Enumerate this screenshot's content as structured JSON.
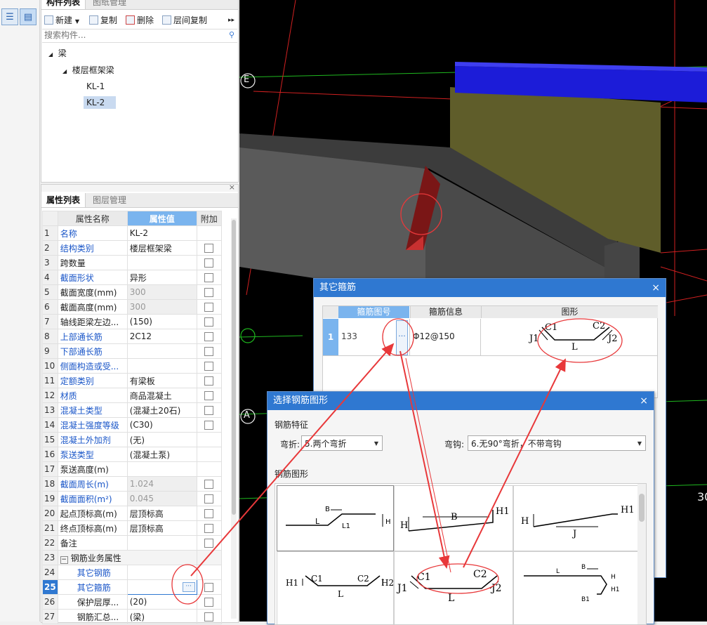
{
  "left_toolbar": {
    "list_icon": "list-view-icon",
    "detail_icon": "detail-view-icon"
  },
  "component_panel": {
    "tabs": [
      "构件列表",
      "图纸管理"
    ],
    "toolbar": {
      "new": "新建",
      "copy": "复制",
      "delete": "删除",
      "floor_copy": "层间复制",
      "more": "▸▸"
    },
    "search_placeholder": "搜索构件...",
    "tree": {
      "root": "梁",
      "category": "楼层框架梁",
      "items": [
        "KL-1",
        "KL-2"
      ],
      "selected": "KL-2"
    }
  },
  "property_panel": {
    "tabs": [
      "属性列表",
      "图层管理"
    ],
    "close": "×",
    "headers": {
      "name": "属性名称",
      "value": "属性值",
      "extra": "附加"
    },
    "rows": [
      {
        "n": "1",
        "name": "名称",
        "value": "KL-2",
        "blue": true,
        "cb": false,
        "gray": false
      },
      {
        "n": "2",
        "name": "结构类别",
        "value": "楼层框架梁",
        "blue": true,
        "cb": true,
        "gray": false
      },
      {
        "n": "3",
        "name": "跨数量",
        "value": "",
        "blue": false,
        "cb": true,
        "gray": false
      },
      {
        "n": "4",
        "name": "截面形状",
        "value": "异形",
        "blue": true,
        "cb": true,
        "gray": false
      },
      {
        "n": "5",
        "name": "截面宽度(mm)",
        "value": "300",
        "blue": false,
        "cb": true,
        "gray": true
      },
      {
        "n": "6",
        "name": "截面高度(mm)",
        "value": "300",
        "blue": false,
        "cb": true,
        "gray": true
      },
      {
        "n": "7",
        "name": "轴线距梁左边...",
        "value": "(150)",
        "blue": false,
        "cb": true,
        "gray": false
      },
      {
        "n": "8",
        "name": "上部通长筋",
        "value": "2C12",
        "blue": true,
        "cb": true,
        "gray": false
      },
      {
        "n": "9",
        "name": "下部通长筋",
        "value": "",
        "blue": true,
        "cb": true,
        "gray": false
      },
      {
        "n": "10",
        "name": "侧面构造或受...",
        "value": "",
        "blue": true,
        "cb": true,
        "gray": false
      },
      {
        "n": "11",
        "name": "定额类别",
        "value": "有梁板",
        "blue": true,
        "cb": true,
        "gray": false
      },
      {
        "n": "12",
        "name": "材质",
        "value": "商品混凝土",
        "blue": true,
        "cb": true,
        "gray": false
      },
      {
        "n": "13",
        "name": "混凝土类型",
        "value": "(混凝土20石)",
        "blue": true,
        "cb": true,
        "gray": false
      },
      {
        "n": "14",
        "name": "混凝土强度等级",
        "value": "(C30)",
        "blue": true,
        "cb": true,
        "gray": false
      },
      {
        "n": "15",
        "name": "混凝土外加剂",
        "value": "(无)",
        "blue": true,
        "cb": false,
        "gray": false
      },
      {
        "n": "16",
        "name": "泵送类型",
        "value": "(混凝土泵)",
        "blue": true,
        "cb": false,
        "gray": false
      },
      {
        "n": "17",
        "name": "泵送高度(m)",
        "value": "",
        "blue": false,
        "cb": false,
        "gray": false
      },
      {
        "n": "18",
        "name": "截面周长(m)",
        "value": "1.024",
        "blue": true,
        "cb": true,
        "gray": true
      },
      {
        "n": "19",
        "name": "截面面积(m²)",
        "value": "0.045",
        "blue": true,
        "cb": true,
        "gray": true
      },
      {
        "n": "20",
        "name": "起点顶标高(m)",
        "value": "层顶标高",
        "blue": false,
        "cb": true,
        "gray": false
      },
      {
        "n": "21",
        "name": "终点顶标高(m)",
        "value": "层顶标高",
        "blue": false,
        "cb": true,
        "gray": false
      },
      {
        "n": "22",
        "name": "备注",
        "value": "",
        "blue": false,
        "cb": true,
        "gray": false
      },
      {
        "n": "23",
        "name": "钢筋业务属性",
        "value": "",
        "blue": false,
        "cb": false,
        "gray": false,
        "group": true
      },
      {
        "n": "24",
        "name": "其它钢筋",
        "value": "",
        "blue": true,
        "cb": false,
        "gray": false,
        "indent": true
      },
      {
        "n": "25",
        "name": "其它箍筋",
        "value": "",
        "blue": true,
        "cb": true,
        "gray": false,
        "indent": true,
        "active": true
      },
      {
        "n": "26",
        "name": "保护层厚...",
        "value": "(20)",
        "blue": false,
        "cb": true,
        "gray": false,
        "indent": true
      },
      {
        "n": "27",
        "name": "钢筋汇总...",
        "value": "(梁)",
        "blue": false,
        "cb": true,
        "gray": false,
        "indent": true
      }
    ],
    "ellipsis": "···",
    "group_toggle": "−"
  },
  "viewport": {
    "axis_labels": [
      "E",
      "A"
    ],
    "edge_text": "30"
  },
  "dialog_stirrup": {
    "title": "其它箍筋",
    "close": "×",
    "headers": [
      "箍筋图号",
      "箍筋信息",
      "图形"
    ],
    "row": {
      "n": "1",
      "code": "133",
      "button": "···",
      "info": "Φ12@150"
    },
    "shape_labels": [
      "C1",
      "C2",
      "J1",
      "J2",
      "L"
    ]
  },
  "dialog_shape": {
    "title": "选择钢筋图形",
    "close": "×",
    "section_features": "钢筋特征",
    "bend_label": "弯折:",
    "bend_value": "5.两个弯折",
    "hook_label": "弯钩:",
    "hook_value": "6.无90°弯折，不带弯钩",
    "section_shapes": "钢筋图形",
    "shapes": [
      {
        "labels": [
          "B",
          "L",
          "L1",
          "H"
        ]
      },
      {
        "labels": [
          "B",
          "H1",
          "H"
        ]
      },
      {
        "labels": [
          "H",
          "H1",
          "J"
        ]
      },
      {
        "labels": [
          "H1",
          "C1",
          "C2",
          "H2",
          "L"
        ]
      },
      {
        "labels": [
          "C1",
          "C2",
          "J1",
          "J2",
          "L"
        ]
      },
      {
        "labels": [
          "B",
          "L",
          "H",
          "B1",
          "H1"
        ]
      }
    ]
  },
  "colors": {
    "accent": "#2f78d1",
    "annotation": "#e8383a",
    "header_blue": "#7ab4ee"
  }
}
